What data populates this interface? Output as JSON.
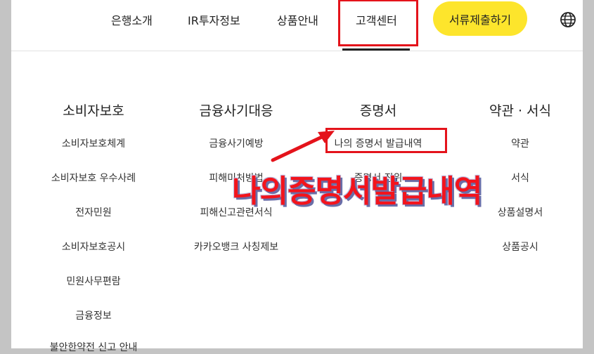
{
  "nav": {
    "items": [
      "은행소개",
      "IR투자정보",
      "상품안내",
      "고객센터"
    ],
    "cta": "서류제출하기",
    "globe_icon": "globe-icon",
    "active_index": 3
  },
  "columns": [
    {
      "title": "소비자보호",
      "links": [
        "소비자보호체계",
        "소비자보호 우수사례",
        "전자민원",
        "소비자보호공시",
        "민원사무편람",
        "금융정보",
        "불안한약전 신고 안내"
      ]
    },
    {
      "title": "금융사기대응",
      "links": [
        "금융사기예방",
        "피해미처방법",
        "피해신고관련서식",
        "카카오뱅크 사칭제보"
      ]
    },
    {
      "title": "증명서",
      "links": [
        "나의 증명서 발급내역",
        "증명서 진위"
      ]
    },
    {
      "title": "약관 · 서식",
      "links": [
        "약관",
        "서식",
        "상품설명서",
        "상품공시"
      ]
    }
  ],
  "annotation": {
    "text": "나의증명서발급내역",
    "color": "#e4131b"
  }
}
